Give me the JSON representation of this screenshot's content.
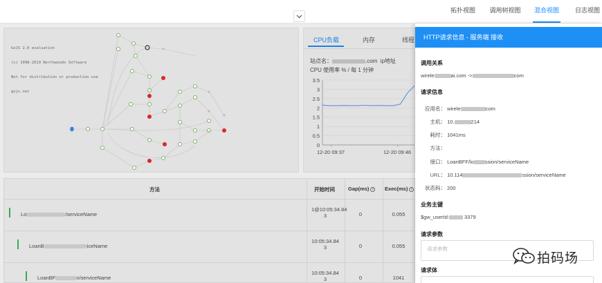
{
  "nav": {
    "tabs": [
      {
        "label": "拓扑视图",
        "active": false
      },
      {
        "label": "调用树视图",
        "active": false
      },
      {
        "label": "混合视图",
        "active": true
      },
      {
        "label": "日志视图",
        "active": false
      }
    ],
    "collapse_icon": "chevron-down-icon"
  },
  "graph": {
    "eval_text": [
      "GoJS 2.0 evaluation",
      "(c) 1998-2019 Northwoods Software",
      "Not for distribution or production use",
      "gojs.net"
    ]
  },
  "cpu": {
    "tabs": [
      {
        "label": "CPU负载",
        "active": true
      },
      {
        "label": "内存",
        "active": false
      },
      {
        "label": "线程",
        "active": false
      }
    ],
    "site_label": "站点名：",
    "site_value_tail": ".com",
    "ip_label": "ip地址",
    "rate_label": "CPU 使用率 % / 每 1 分钟"
  },
  "chart_data": {
    "type": "line",
    "title": "",
    "xlabel": "",
    "ylabel": "",
    "x_ticks": [
      "12-20 09:37",
      "12-20 09:46"
    ],
    "y_ticks": [
      "0",
      "0.5",
      "1",
      "1.5",
      "2",
      "2.5",
      "3",
      "3.5"
    ],
    "ylim": [
      0,
      3.5
    ],
    "grid": true,
    "series": [
      {
        "values": [
          2.15,
          2.12,
          2.12,
          2.13,
          2.12,
          2.12,
          2.14,
          2.12,
          2.13,
          2.12,
          2.12,
          2.2,
          2.8,
          3.2
        ]
      }
    ],
    "color": "#5a8fe0"
  },
  "table": {
    "headers": {
      "method": "方法",
      "start": "开始时间",
      "gap": "Gap(ms)",
      "exec": "Exec(ms)"
    },
    "rows": [
      {
        "name_head": "Lo",
        "name_tail": "/serviceName",
        "time": "10:05:34.84 3",
        "time_prefix": "1@",
        "gap": "0",
        "exec": "0.055",
        "indent": 0
      },
      {
        "name_head": "LoanB",
        "name_tail": "iceName",
        "time": "10:05:34.84 3",
        "time_prefix": "",
        "gap": "0",
        "exec": "0.055",
        "indent": 1
      },
      {
        "name_head": "LoanBF",
        "name_tail": "n/serviceName",
        "time": "10:05:34.84 3",
        "time_prefix": "",
        "gap": "0",
        "exec": "1041",
        "indent": 2
      }
    ]
  },
  "drawer": {
    "title": "HTTP请求信息 - 服务端 接收",
    "call_relation_title": "调用关系",
    "call_relation_value": [
      "wirele",
      "ai.com ->",
      "com"
    ],
    "request_info_title": "请求信息",
    "request_info": [
      {
        "key": "应用名：",
        "value_head": "wirele",
        "value_tail": "com"
      },
      {
        "key": "主机：",
        "value_head": "10.",
        "value_tail": "214"
      },
      {
        "key": "耗时：",
        "value_head": "1041ms",
        "value_tail": ""
      },
      {
        "key": "方法：",
        "value_head": "",
        "value_tail": ""
      },
      {
        "key": "接口：",
        "value_head": "LoanBFF/lo",
        "value_tail": "ssion/serviceName"
      },
      {
        "key": "URL：",
        "value_head": "10.114",
        "value_tail": "ssion/serviceName"
      },
      {
        "key": "状态码：",
        "value_head": "200",
        "value_tail": ""
      }
    ],
    "biz_key_title": "业务主键",
    "biz_key_value_head": "$gw_userId:",
    "biz_key_value_tail": "3379",
    "request_params_title": "请求参数",
    "request_params_placeholder": "请求参数",
    "request_body_title": "请求体"
  },
  "watermark": {
    "text": "拍码场",
    "icon": "wechat-icon"
  }
}
